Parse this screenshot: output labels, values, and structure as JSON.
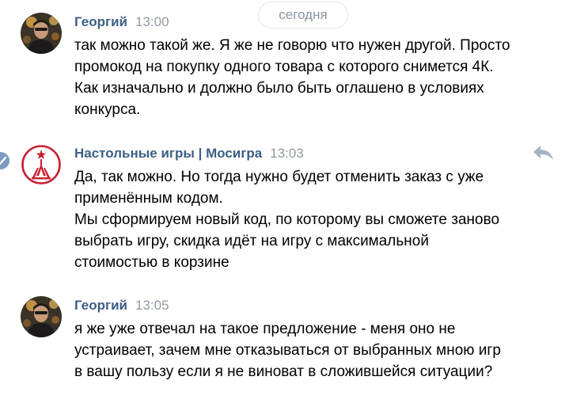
{
  "date_divider": "сегодня",
  "messages": [
    {
      "author": "Георгий",
      "time": "13:00",
      "avatar": "user-photo-avatar",
      "lines": [
        "так можно такой же. Я же не говорю что нужен другой. Просто",
        "промокод на покупку одного товара с которого снимется 4К.",
        "Как изначально и должно было быть оглашено в условиях",
        "конкурса."
      ]
    },
    {
      "author": "Настольные игры | Мосигра",
      "time": "13:03",
      "avatar": "mosigra-logo",
      "lines": [
        "Да, так можно. Но тогда нужно будет отменить заказ с уже",
        "применённым кодом.",
        "Мы сформируем новый код, по которому вы сможете заново",
        "выбрать игру, скидка идёт на игру с максимальной",
        "стоимостью в корзине"
      ]
    },
    {
      "author": "Георгий",
      "time": "13:05",
      "avatar": "user-photo-avatar",
      "lines": [
        "я же уже отвечал на такое предложение - меня оно не",
        "устраивает, зачем мне отказываться от выбранных мною игр",
        "в вашу пользу если я не виноват в сложившейся ситуации?"
      ]
    }
  ],
  "icons": {
    "reply": "reply-icon",
    "selected": "checkmark-icon"
  },
  "colors": {
    "author": "#3c5f86",
    "time": "#939aa3",
    "text": "#000000",
    "logo_red": "#c8202f",
    "reply_icon": "#aab4c0",
    "select_mark": "#7d9bc0"
  }
}
